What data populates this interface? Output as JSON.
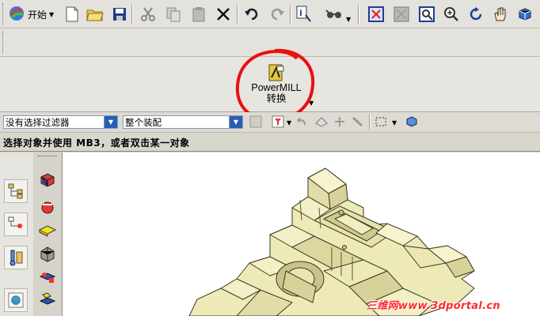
{
  "toolbar_main": {
    "start_label": "开始",
    "icons": [
      "start-icon",
      "new-file-icon",
      "open-folder-icon",
      "save-icon",
      "cut-icon",
      "copy-icon",
      "paste-icon",
      "delete-icon",
      "undo-icon",
      "redo-icon",
      "info-icon",
      "glasses-icon",
      "fit-view-icon",
      "refresh-view-icon",
      "zoom-window-icon",
      "zoom-icon",
      "rotate-icon",
      "pan-icon",
      "shaded-view-icon"
    ]
  },
  "ribbon": {
    "powermill_label": "PowerMILL",
    "powermill_sublabel": "转换"
  },
  "filter_bar": {
    "filter_value": "没有选择过滤器",
    "scope_value": "整个装配"
  },
  "status": {
    "prompt": "选择对象并使用 MB3，或者双击某一对象"
  },
  "watermark": "三维网www.3dportal.cn",
  "colors": {
    "annotation_circle": "#e81010",
    "model_fill": "#eeeab8",
    "model_edge": "#3a3a20",
    "accent_blue": "#2a5db7"
  }
}
